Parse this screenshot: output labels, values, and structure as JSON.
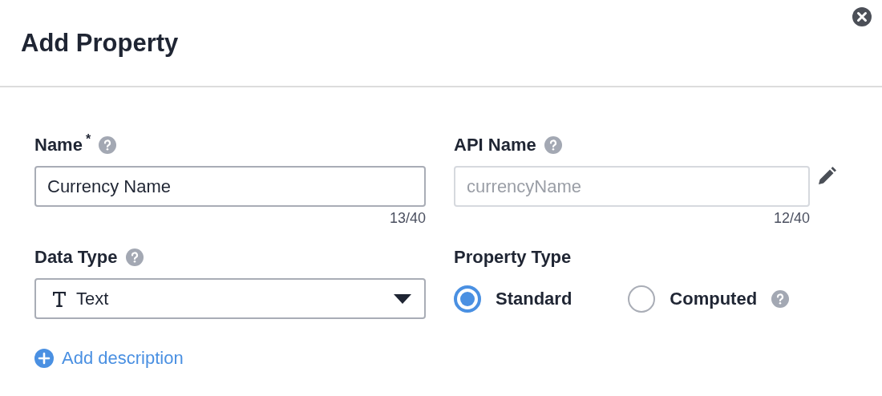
{
  "dialog": {
    "title": "Add Property"
  },
  "name_field": {
    "label": "Name",
    "required_mark": "*",
    "help": true,
    "value": "Currency Name",
    "counter": "13/40"
  },
  "api_name_field": {
    "label": "API Name",
    "help": true,
    "value": "currencyName",
    "disabled": true,
    "counter": "12/40"
  },
  "data_type_field": {
    "label": "Data Type",
    "help": true,
    "value": "Text"
  },
  "property_type": {
    "label": "Property Type",
    "options": [
      {
        "label": "Standard",
        "selected": true,
        "help": false
      },
      {
        "label": "Computed",
        "selected": false,
        "help": true
      }
    ]
  },
  "add_description": {
    "label": "Add description"
  }
}
